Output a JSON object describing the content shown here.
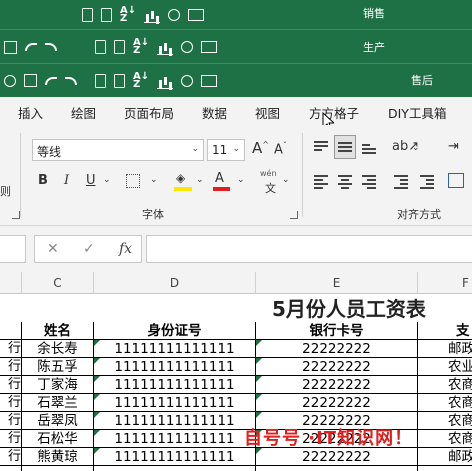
{
  "titlebars": [
    {
      "title": "销售"
    },
    {
      "title": "生产"
    },
    {
      "title": "售后"
    }
  ],
  "ribbon": {
    "tabs": [
      "插入",
      "绘图",
      "页面布局",
      "数据",
      "视图",
      "方方格子",
      "DIY工具箱"
    ],
    "font_name": "等线",
    "font_size": "11",
    "wen_label": "wén",
    "wen_char": "文",
    "group_font": "字体",
    "group_align": "对齐方式",
    "left_edge_label": "则",
    "btn_bold": "B",
    "btn_italic": "I",
    "btn_underline": "U",
    "btn_grow": "A",
    "btn_shrink": "A",
    "font_color_letter": "A",
    "highlight_letter": "A"
  },
  "formula_bar": {
    "cancel": "✕",
    "enter": "✓",
    "fx": "fx",
    "value": ""
  },
  "columns": [
    "C",
    "D",
    "E",
    "F"
  ],
  "sheet": {
    "title": "5月份人员工资表",
    "headers": [
      "姓名",
      "身份证号",
      "银行卡号",
      "支"
    ],
    "rows": [
      {
        "name": "余长寿",
        "id": "11111111111111",
        "card": "22222222",
        "bank": "邮政"
      },
      {
        "name": "陈五孚",
        "id": "11111111111111",
        "card": "22222222",
        "bank": "农业"
      },
      {
        "name": "丁家海",
        "id": "11111111111111",
        "card": "22222222",
        "bank": "农商"
      },
      {
        "name": "石翠兰",
        "id": "11111111111111",
        "card": "22222222",
        "bank": "农商"
      },
      {
        "name": "岳翠凤",
        "id": "11111111111111",
        "card": "22222222",
        "bank": "农商"
      },
      {
        "name": "石松华",
        "id": "11111111111111",
        "card": "22222222",
        "bank": "农商"
      },
      {
        "name": "熊黄琼",
        "id": "11111111111111",
        "card": "22222222",
        "bank": "邮政"
      }
    ],
    "left_partial": "行"
  },
  "watermark": "自号号 ·IT知识网！",
  "colors": {
    "title_green": "#1e7145",
    "font_red": "#e0201e",
    "highlight_yellow": "#ffe600"
  }
}
